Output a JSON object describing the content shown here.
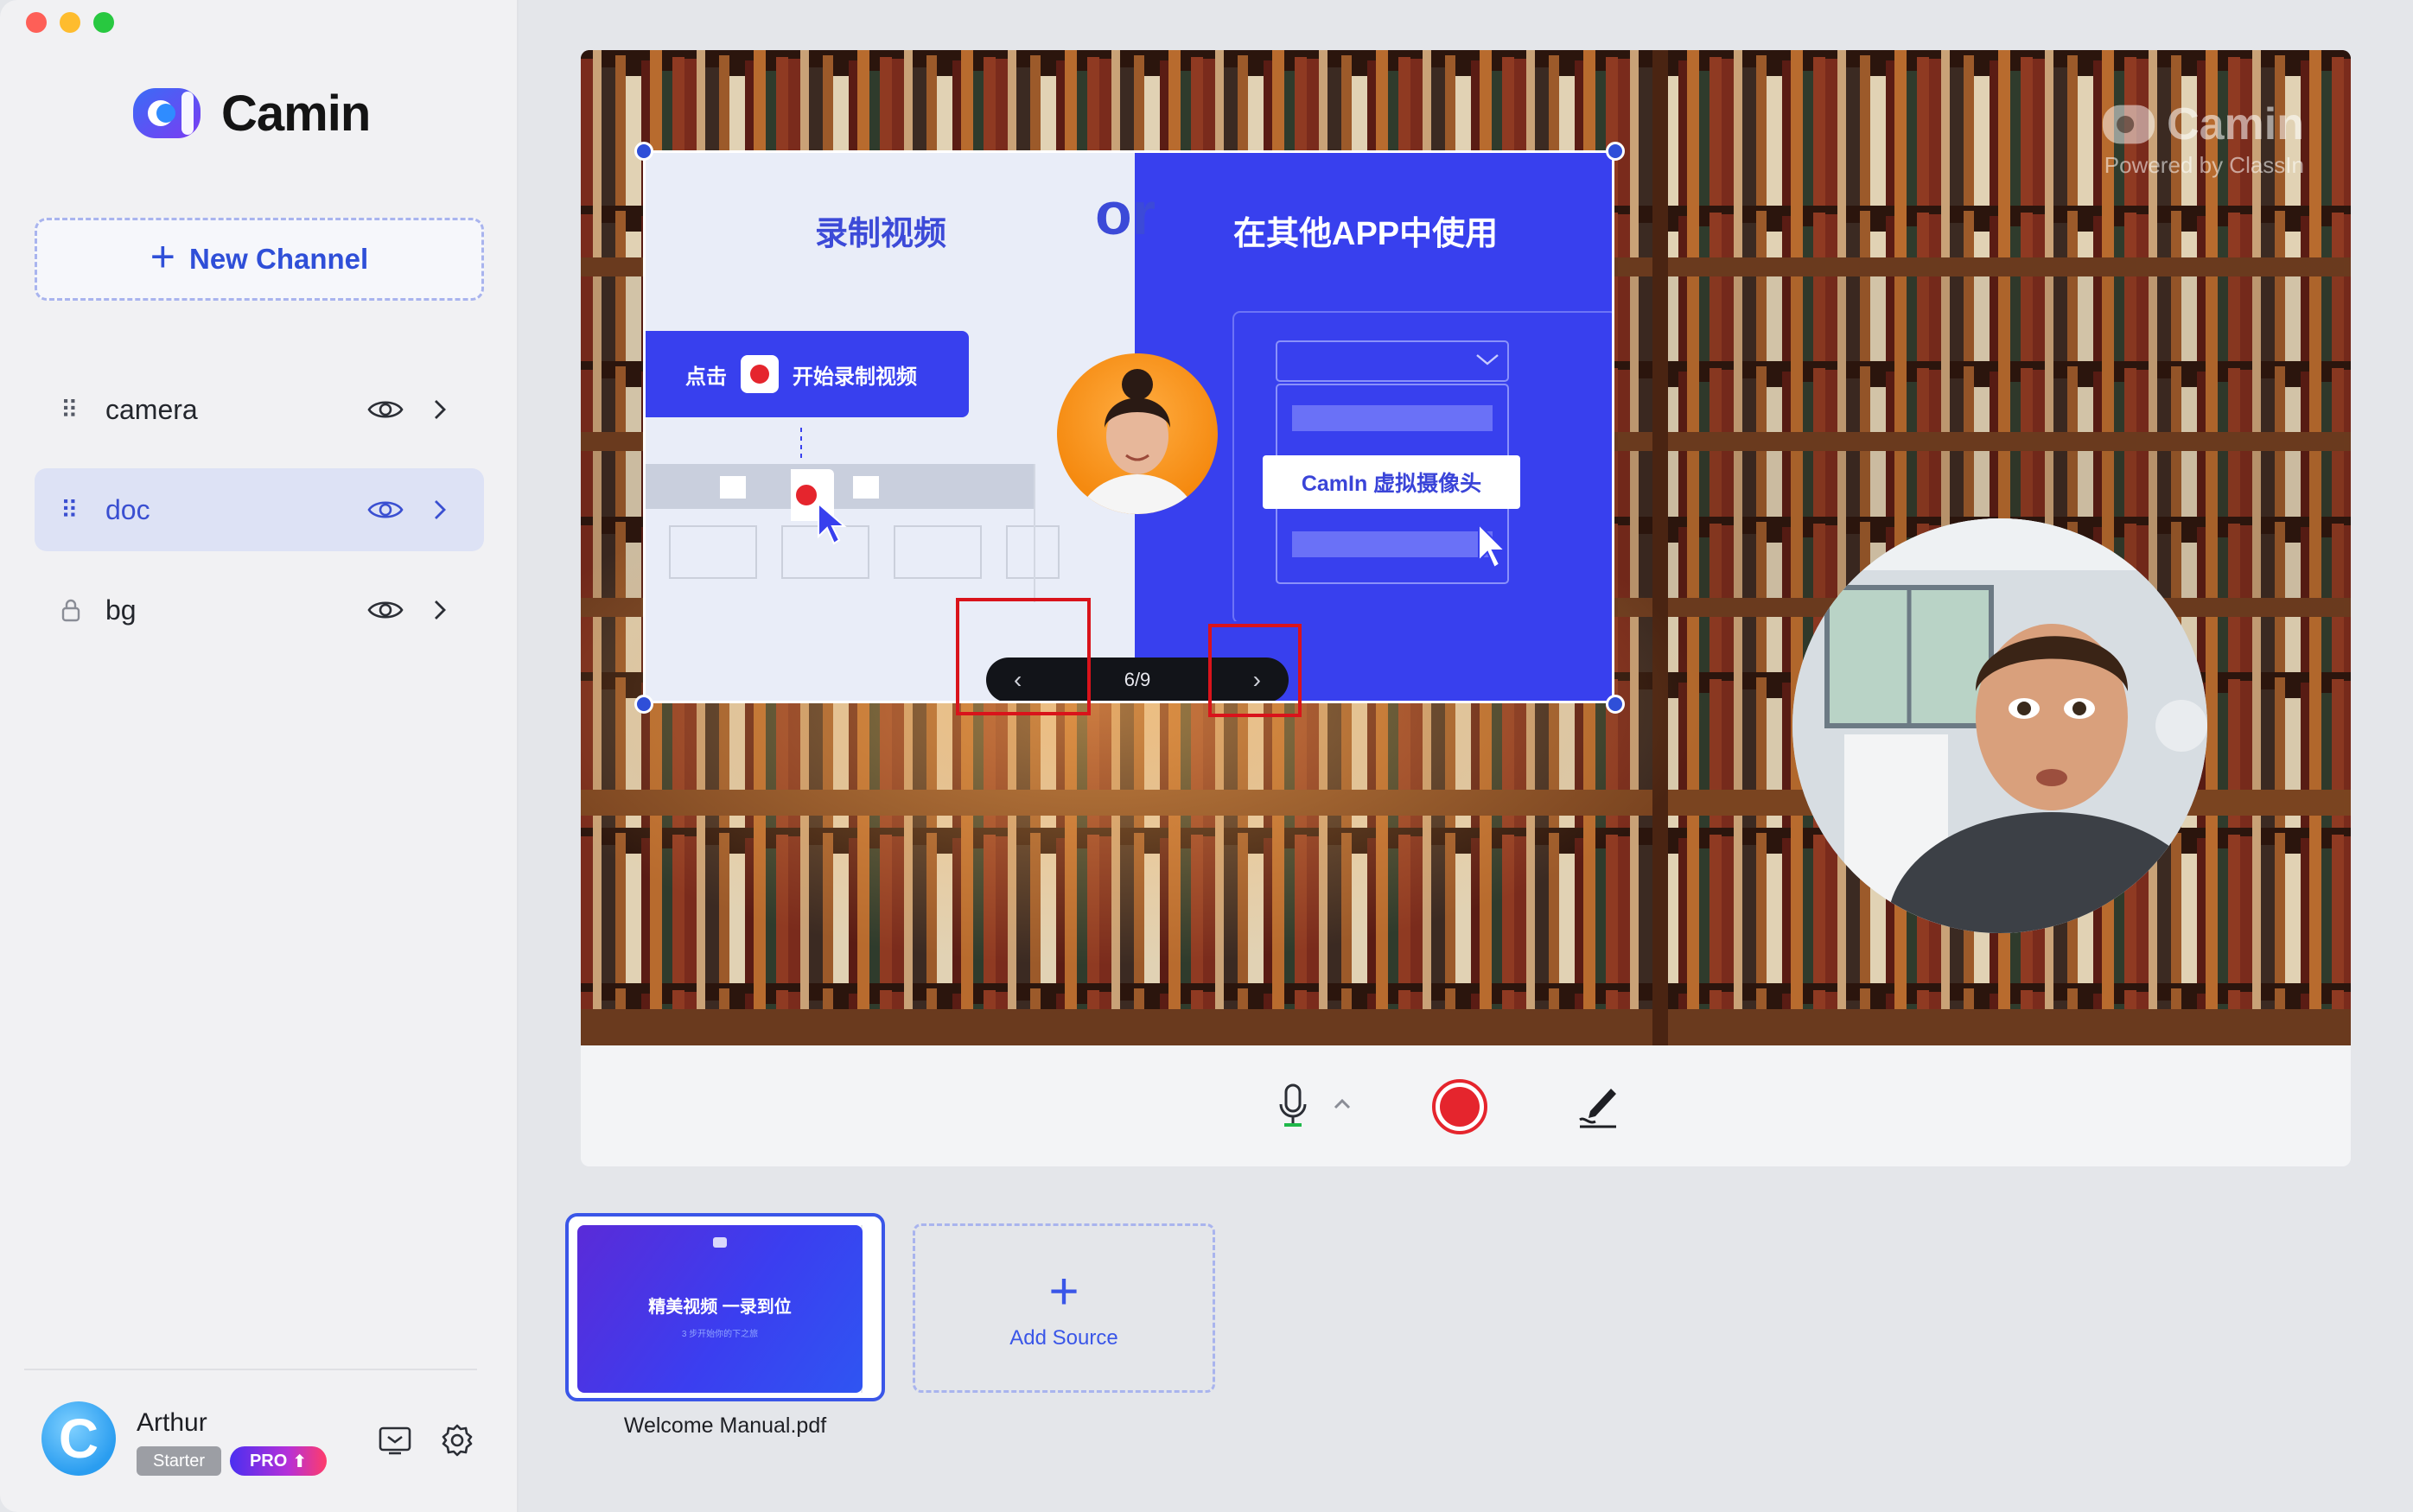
{
  "app": {
    "name": "Camin"
  },
  "sidebar": {
    "new_channel_label": "New Channel",
    "channels": [
      {
        "label": "camera",
        "active": false,
        "locked": false
      },
      {
        "label": "doc",
        "active": true,
        "locked": false
      },
      {
        "label": "bg",
        "active": false,
        "locked": true
      }
    ]
  },
  "user": {
    "name": "Arthur",
    "avatar_letter": "C",
    "plan": "Starter",
    "upgrade_badge": "PRO"
  },
  "preview": {
    "watermark_title": "Camin",
    "watermark_sub": "Powered by ClassIn",
    "document": {
      "left_title": "录制视频",
      "or_text": "or",
      "right_title": "在其他APP中使用",
      "click_text": "点击",
      "start_record_text": "开始录制视频",
      "camin_button_text": "CamIn 虚拟摄像头",
      "page_indicator": "6/9"
    }
  },
  "sources": {
    "items": [
      {
        "label": "Welcome Manual.pdf",
        "thumb_title": "精美视频  一录到位",
        "thumb_sub": "3 步开始你的下之旅"
      }
    ],
    "add_label": "Add Source"
  },
  "colors": {
    "accent": "#3a56e8",
    "record": "#e5252d",
    "highlight_box": "#d9131b",
    "doc_blue": "#3840ee"
  }
}
